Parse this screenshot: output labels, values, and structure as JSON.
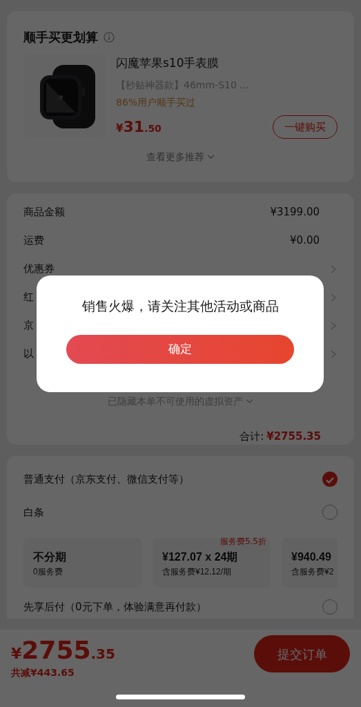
{
  "recommend": {
    "title": "顺手买更划算",
    "product": {
      "name": "闪魔苹果s10手表膜",
      "spec": "【秒贴神器款】46mm-S10  ...",
      "note": "86%用户顺手买过",
      "price": {
        "symbol": "¥",
        "whole": "31",
        "fraction": ".50"
      },
      "button": "一键购买"
    },
    "more": "查看更多推荐"
  },
  "summary": {
    "rows": [
      {
        "label": "商品金额",
        "value": "¥3199.00",
        "chevron": false
      },
      {
        "label": "运费",
        "value": "¥0.00",
        "chevron": false
      },
      {
        "label": "优惠券",
        "chevron": true
      },
      {
        "label": "红",
        "chevron": true
      },
      {
        "label": "京",
        "chevron": true
      },
      {
        "label": "以",
        "chevron": true
      }
    ],
    "hidden_note": "已隐藏本单不可使用的虚拟资产",
    "total_label": "合计:",
    "total": "¥2755.35"
  },
  "payment": {
    "options": [
      {
        "label": "普通支付（京东支付、微信支付等）",
        "selected": true
      },
      {
        "label": "白条",
        "selected": false,
        "plans": [
          {
            "title": "不分期",
            "subtitle": "0服务费"
          },
          {
            "title": "¥127.07 x 24期",
            "subtitle": "含服务费¥12.12/期",
            "tag": "服务费5.5折"
          },
          {
            "title": "¥940.49",
            "subtitle": "含服务费¥2"
          }
        ]
      },
      {
        "label": "先享后付（0元下单，体验满意再付款）",
        "selected": false
      }
    ]
  },
  "footer": {
    "price": {
      "symbol": "¥",
      "whole": "2755",
      "fraction": ".35"
    },
    "saving": "共减¥443.65",
    "submit": "提交订单"
  },
  "dialog": {
    "message": "销售火爆，请关注其他活动或商品",
    "confirm": "确定"
  }
}
